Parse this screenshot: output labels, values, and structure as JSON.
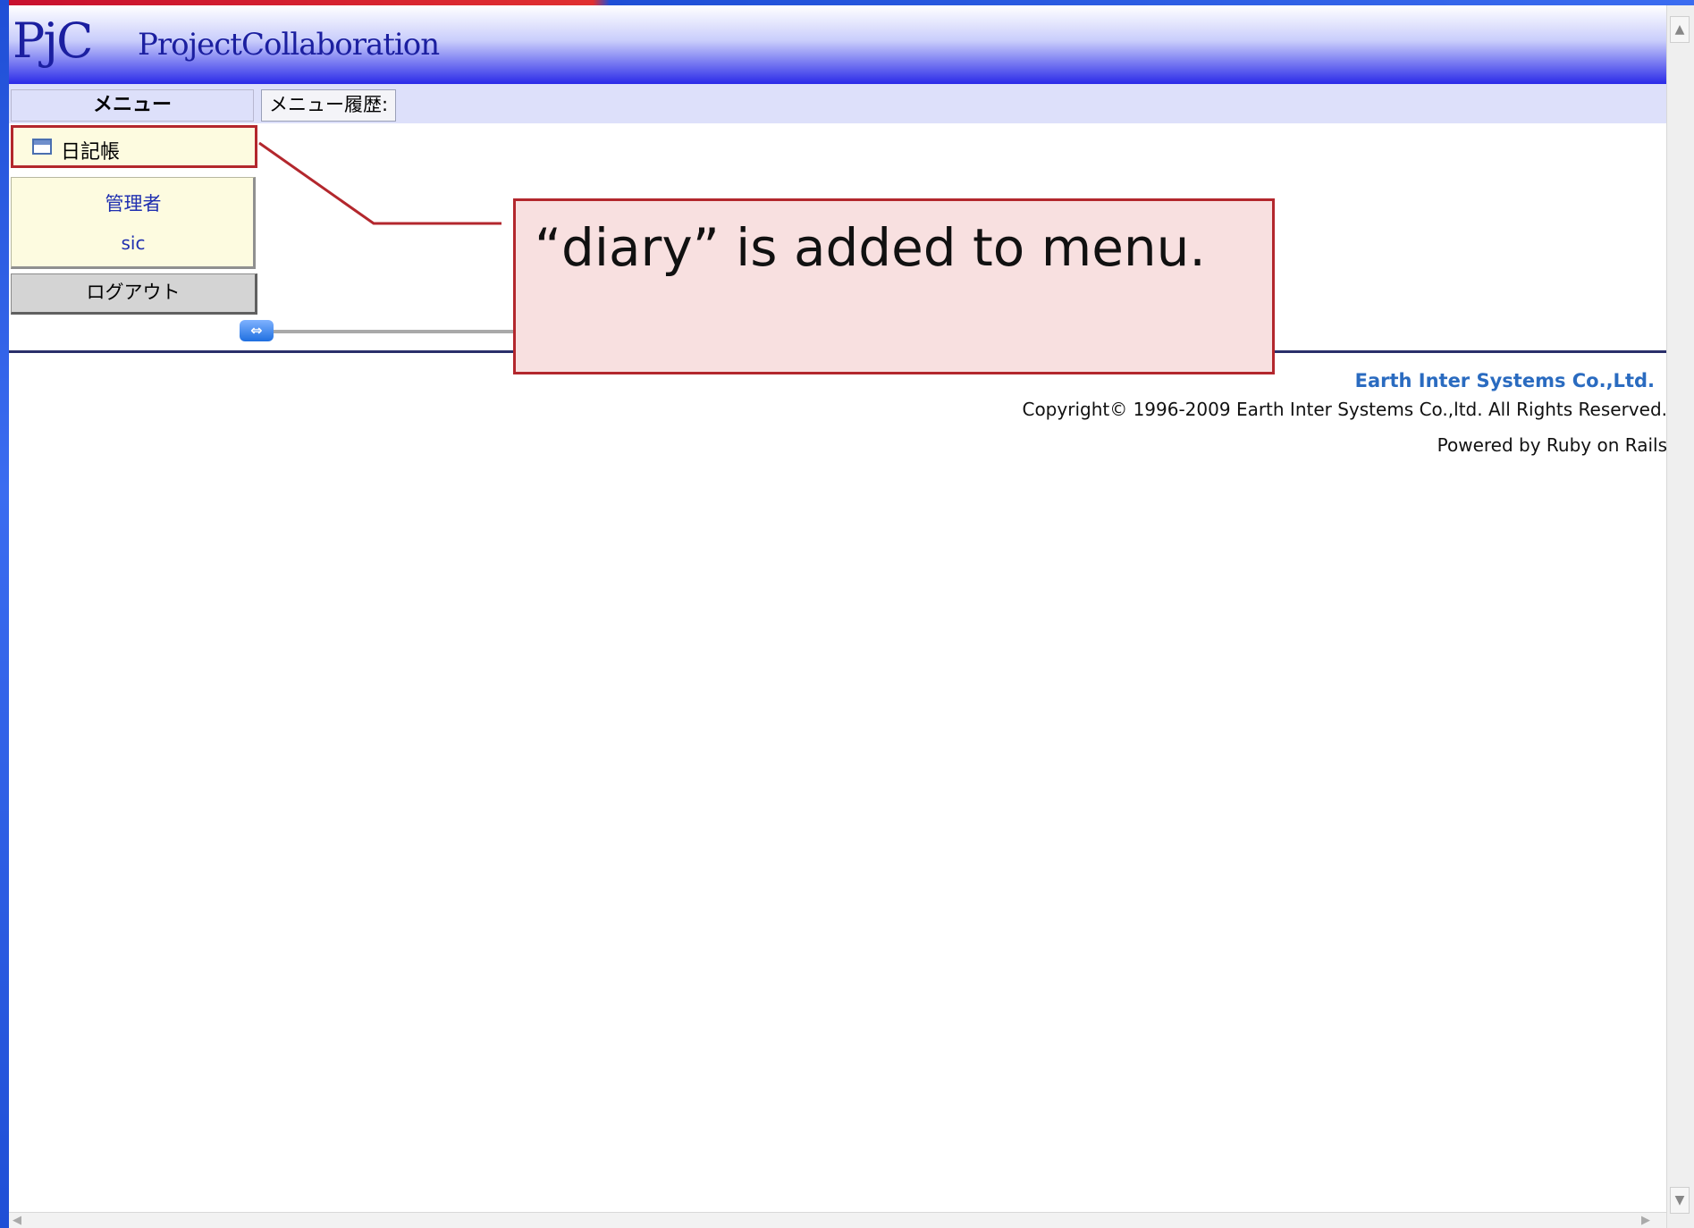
{
  "header": {
    "logo_mark": "PjC",
    "logo_text": "ProjectCollaboration"
  },
  "menubar": {
    "menu_title": "メニュー",
    "history_label": "メニュー履歴:"
  },
  "sidebar": {
    "diary_item": {
      "label": "日記帳",
      "icon": "window-icon"
    },
    "user": {
      "role": "管理者",
      "name": "sic"
    },
    "logout_label": "ログアウト",
    "resize_icon": "horizontal-resize-icon"
  },
  "footer": {
    "company": "Earth Inter Systems Co.,Ltd.",
    "copyright": "Copyright© 1996-2009 Earth Inter Systems Co.,ltd. All Rights Reserved.",
    "powered_by": "Powered by Ruby on Rails"
  },
  "callout": {
    "text": "“diary” is added to menu."
  },
  "colors": {
    "accent_blue": "#2a2ae8",
    "menu_bg": "#dde0fa",
    "highlight_red": "#b3272d",
    "callout_bg": "#f8e0e0"
  }
}
